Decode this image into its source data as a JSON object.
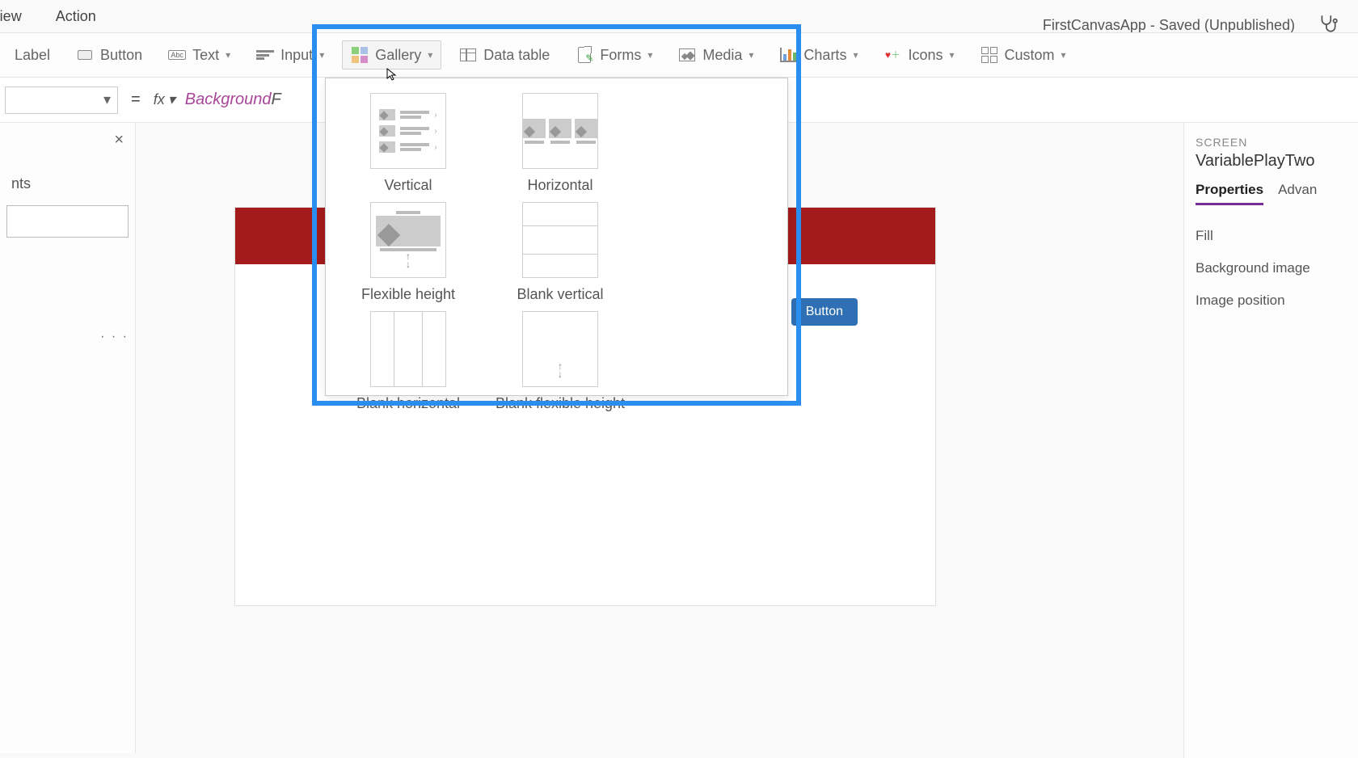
{
  "menubar": {
    "view": "View",
    "action": "Action"
  },
  "title": "FirstCanvasApp - Saved (Unpublished)",
  "ribbon": {
    "label": "Label",
    "button": "Button",
    "text": "Text",
    "input": "Input",
    "gallery": "Gallery",
    "data_table": "Data table",
    "forms": "Forms",
    "media": "Media",
    "charts": "Charts",
    "icons": "Icons",
    "custom": "Custom"
  },
  "formula": {
    "equals": "=",
    "fx": "fx",
    "prop_prefix": "Background",
    "prop_suffix": "F"
  },
  "left_panel": {
    "heading_suffix": "nts",
    "close": "×",
    "dots": "· · ·"
  },
  "dropdown": {
    "items": [
      {
        "label": "Vertical"
      },
      {
        "label": "Horizontal"
      },
      {
        "label": "Flexible height"
      },
      {
        "label": "Blank vertical"
      },
      {
        "label": "Blank horizontal"
      },
      {
        "label": "Blank flexible height"
      }
    ]
  },
  "canvas": {
    "button_label": "Button"
  },
  "props": {
    "heading": "SCREEN",
    "screen_name": "VariablePlayTwo",
    "tabs": {
      "properties": "Properties",
      "advanced": "Advan"
    },
    "rows": {
      "fill": "Fill",
      "bg_image": "Background image",
      "img_pos": "Image position"
    }
  }
}
